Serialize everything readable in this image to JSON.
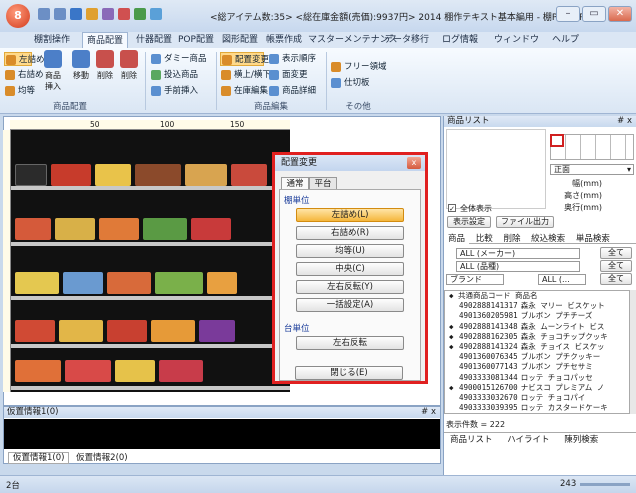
{
  "app": {
    "title": "<総アイテム数:35> <総在庫金額(売価):9937円> 2014 棚作テキスト基本編用 - 棚POWER",
    "menu_button": "8"
  },
  "window_buttons": [
    "–",
    "▭",
    "✕"
  ],
  "tabs": [
    "棚割操作",
    "商品配置",
    "什器配置",
    "POP配置",
    "図形配置",
    "帳票作成",
    "マスターメンテナンス",
    "データ移行",
    "ログ情報",
    "ウィンドウ",
    "ヘルプ"
  ],
  "ribbon": {
    "group1": {
      "small": [
        "左詰め",
        "右詰め",
        "均等"
      ],
      "big": [
        "商品挿入",
        "移動",
        "削除",
        "削除"
      ],
      "label": "商品配置"
    },
    "group2": {
      "items": [
        "ダミー商品",
        "投込商品",
        "手前挿入"
      ]
    },
    "group3": {
      "items": [
        "配置変更",
        "表示順序",
        "横上/横下",
        "面変更",
        "在庫編集",
        "商品詳細"
      ],
      "label": "商品編集"
    },
    "group4": {
      "items": [
        "フリー領域",
        "仕切板"
      ],
      "label": "その他"
    }
  },
  "ruler": [
    "50",
    "100",
    "150"
  ],
  "dialog": {
    "title": "配置変更",
    "tabs": [
      "通常",
      "平台"
    ],
    "shelf_unit_label": "棚単位",
    "buttons": [
      "左詰め(L)",
      "右詰め(R)",
      "均等(U)",
      "中央(C)",
      "左右反転(Y)",
      "一括設定(A)"
    ],
    "stand_unit_label": "台単位",
    "stand_button": "左右反転",
    "close_button": "閉じる(E)",
    "close_icon": "x"
  },
  "right_pane": {
    "title": "商品リスト",
    "pin": "# x",
    "face_select": "正面",
    "fields": [
      "幅(mm)",
      "高さ(mm)",
      "奥行(mm)"
    ],
    "all_display_label": "全体表示",
    "settings_button": "表示設定",
    "file_button": "ファイル出力",
    "tabs": [
      "商品",
      "比較",
      "削除",
      "絞込検索",
      "単品検索"
    ],
    "filters": [
      {
        "label": "ALL (メーカー)",
        "btn": "全て"
      },
      {
        "label": "ALL (品種)",
        "btn": "全て"
      },
      {
        "label": "ブランド",
        "value": "ALL (...",
        "btn": "全て"
      }
    ],
    "list_header": {
      "code": "共通商品コード",
      "name": "商品名"
    },
    "rows": [
      {
        "mark": "",
        "code": "4902888141317",
        "name": "森永 マリー ビスケット"
      },
      {
        "mark": "",
        "code": "4901360205981",
        "name": "ブルボン プチチーズ"
      },
      {
        "mark": "◆",
        "code": "4902888141348",
        "name": "森永 ムーンライト ビス"
      },
      {
        "mark": "◆",
        "code": "4902888162305",
        "name": "森永 チョコチップクッキ"
      },
      {
        "mark": "◆",
        "code": "4902888141324",
        "name": "森永 チョイス ビスケッ"
      },
      {
        "mark": "",
        "code": "4901360076345",
        "name": "ブルボン プチクッキー"
      },
      {
        "mark": "",
        "code": "4901360077143",
        "name": "ブルボン プチセサミ"
      },
      {
        "mark": "",
        "code": "4903333081344",
        "name": "ロッテ チョコパッセ"
      },
      {
        "mark": "◆",
        "code": "4900015126700",
        "name": "ナビスコ プレミアム ノ"
      },
      {
        "mark": "",
        "code": "4903333032670",
        "name": "ロッテ チョコパイ"
      },
      {
        "mark": "",
        "code": "4903333039395",
        "name": "ロッテ カスタードケーキ"
      }
    ],
    "count": "表示件数 = 222",
    "bottom_tabs": [
      "商品リスト",
      "ハイライト",
      "陳列検索"
    ]
  },
  "bottom_pane": {
    "title": "仮置情報1(0)",
    "pin": "# x",
    "tabs": [
      "仮置情報1(0)",
      "仮置情報2(0)"
    ]
  },
  "status": {
    "page": "2台",
    "zoom": "243"
  }
}
